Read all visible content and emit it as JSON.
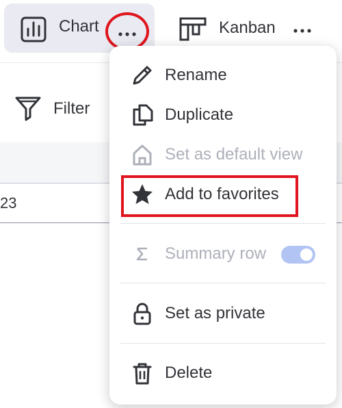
{
  "views": {
    "chart": {
      "label": "Chart",
      "icon": "bar-chart-icon",
      "more_icon": "more-dots-icon"
    },
    "kanban": {
      "label": "Kanban",
      "icon": "kanban-icon",
      "more_icon": "more-dots-icon"
    }
  },
  "toolbar": {
    "filter_label": "Filter",
    "filter_icon": "filter-funnel-icon"
  },
  "table": {
    "cell_text": "23"
  },
  "menu": {
    "items": [
      {
        "label": "Rename",
        "icon": "pencil-icon",
        "disabled": false
      },
      {
        "label": "Duplicate",
        "icon": "duplicate-icon",
        "disabled": false
      },
      {
        "label": "Set as default view",
        "icon": "home-icon",
        "disabled": true
      },
      {
        "label": "Add to favorites",
        "icon": "star-icon",
        "disabled": false
      },
      {
        "label": "Summary row",
        "icon": "sigma-icon",
        "disabled": true,
        "toggle_on": true
      },
      {
        "label": "Set as private",
        "icon": "lock-icon",
        "disabled": false
      },
      {
        "label": "Delete",
        "icon": "trash-icon",
        "disabled": false
      }
    ]
  },
  "colors": {
    "highlight_red": "#e0141c",
    "active_tab_bg": "#e9eaf2",
    "toggle_bg": "#b2c4f3",
    "text_primary": "#323338",
    "text_disabled": "#aeb0ba"
  }
}
